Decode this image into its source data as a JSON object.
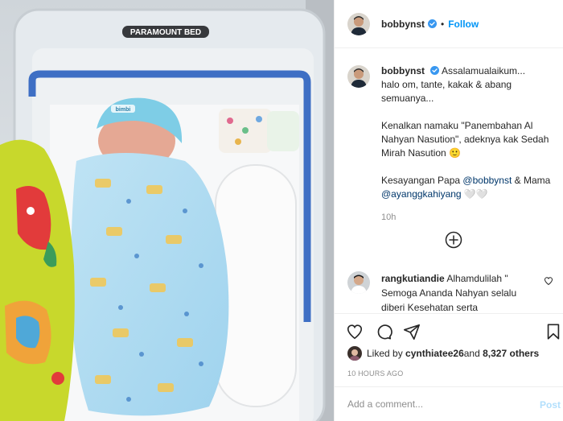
{
  "photo": {
    "label_text": "PARAMOUNT BED",
    "hat_text": "bimbi"
  },
  "header": {
    "username": "bobbynst",
    "separator": "•",
    "follow_label": "Follow"
  },
  "caption": {
    "username": "bobbynst",
    "lines": [
      "Assalamualaikum...",
      "halo om, tante, kakak & abang",
      "semuanya..."
    ],
    "intro": "Kenalkan namaku \"Panembahan Al Nahyan Nasution\", adeknya kak Sedah Mirah Nasution 🙂",
    "love_text": "Kesayangan Papa ",
    "mention_papa": "@bobbynst",
    "love_mid": " & Mama ",
    "mention_mama": "@ayanggkahiyang",
    "love_end": " 🤍🤍",
    "time": "10h"
  },
  "comment": {
    "username": "rangkutiandie",
    "text": "Alhamdulilah \" Semoga Ananda Nahyan selalu diberi Kesehatan serta"
  },
  "likes": {
    "prefix": "Liked by ",
    "user": "cynthiatee26",
    "middle": " and ",
    "count": "8,327 others"
  },
  "posted": "10 HOURS AGO",
  "add_comment": {
    "placeholder": "Add a comment...",
    "post_label": "Post"
  },
  "colors": {
    "accent": "#0095f6",
    "verified": "#3897f0",
    "mention": "#00376b",
    "muted": "#8e8e8e",
    "post_disabled": "#b2dffc"
  },
  "icons": [
    "verified-badge-icon",
    "plus-circle-icon",
    "heart-icon",
    "comment-icon",
    "share-icon",
    "bookmark-icon",
    "heart-small-icon"
  ]
}
